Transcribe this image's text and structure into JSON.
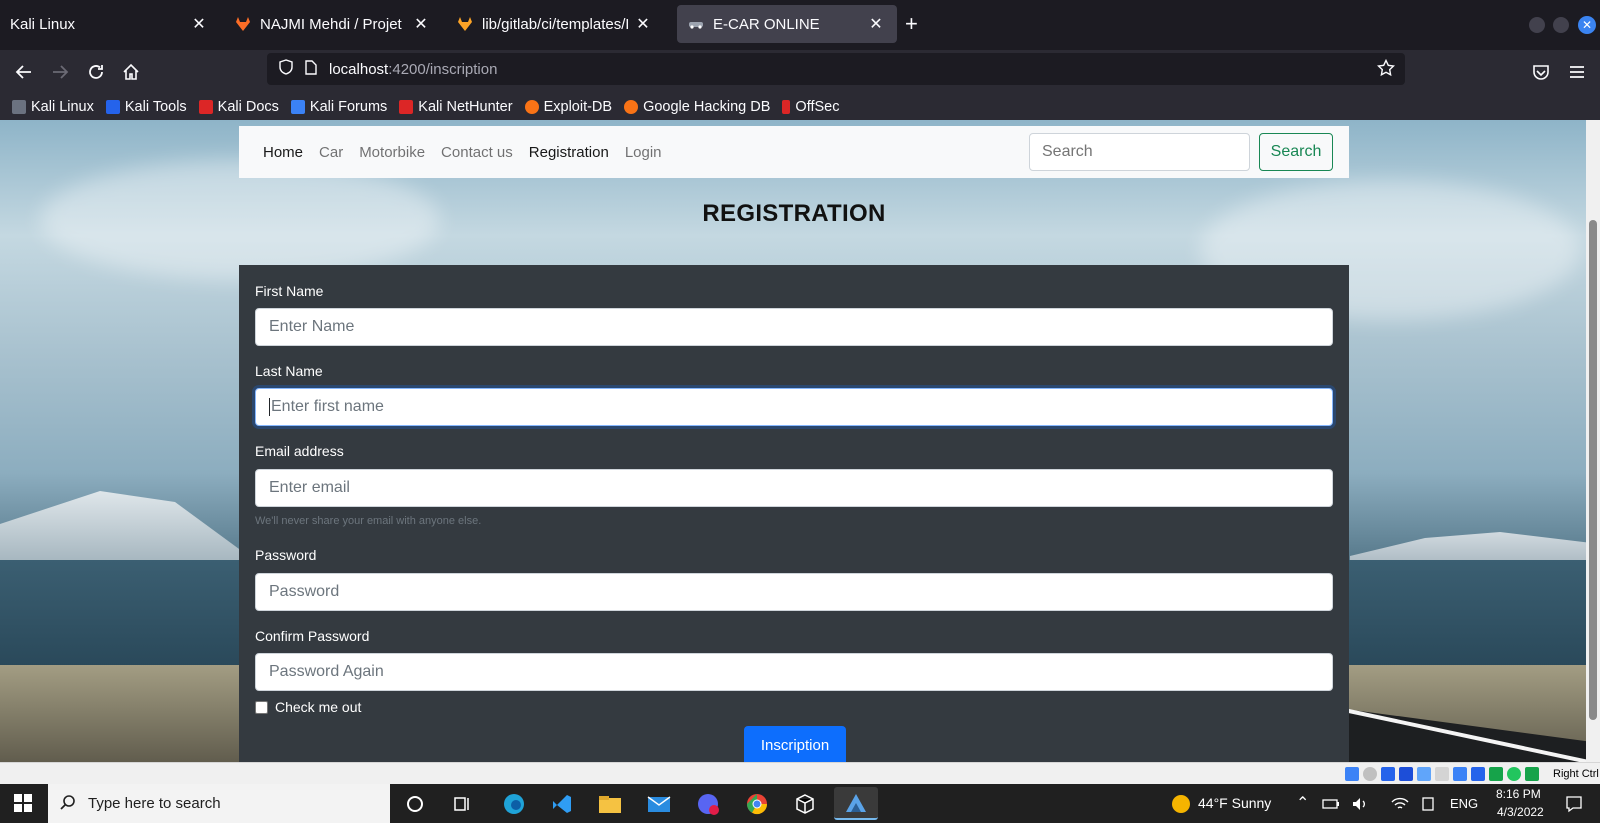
{
  "browser": {
    "tabs": [
      {
        "title": "Kali Linux",
        "active": false
      },
      {
        "title": "NAJMI Mehdi / Projet Full_",
        "active": false
      },
      {
        "title": "lib/gitlab/ci/templates/Do",
        "active": false
      },
      {
        "title": "E-CAR ONLINE",
        "active": true
      }
    ],
    "url": {
      "host": "localhost",
      "path": ":4200/inscription"
    },
    "bookmarks": [
      {
        "label": "Kali Linux",
        "icon": "kali-dragon-icon",
        "color": "#6b7280"
      },
      {
        "label": "Kali Tools",
        "icon": "kali-tools-icon",
        "color": "#2563eb"
      },
      {
        "label": "Kali Docs",
        "icon": "kali-docs-icon",
        "color": "#dc2626"
      },
      {
        "label": "Kali Forums",
        "icon": "kali-forums-icon",
        "color": "#3b82f6"
      },
      {
        "label": "Kali NetHunter",
        "icon": "nethunter-icon",
        "color": "#dc2626"
      },
      {
        "label": "Exploit-DB",
        "icon": "exploit-db-icon",
        "color": "#f97316"
      },
      {
        "label": "Google Hacking DB",
        "icon": "ghdb-icon",
        "color": "#f97316"
      },
      {
        "label": "OffSec",
        "icon": "offsec-icon",
        "color": "#dc2626"
      }
    ]
  },
  "site": {
    "nav": [
      {
        "label": "Home",
        "strong": true
      },
      {
        "label": "Car",
        "strong": false
      },
      {
        "label": "Motorbike",
        "strong": false
      },
      {
        "label": "Contact us",
        "strong": false
      },
      {
        "label": "Registration",
        "strong": true
      },
      {
        "label": "Login",
        "strong": false
      }
    ],
    "search": {
      "placeholder": "Search",
      "button": "Search"
    },
    "title": "REGISTRATION",
    "form": {
      "first_name": {
        "label": "First Name",
        "placeholder": "Enter Name"
      },
      "last_name": {
        "label": "Last Name",
        "placeholder": "Enter first name"
      },
      "email": {
        "label": "Email address",
        "placeholder": "Enter email",
        "help": "We'll never share your email with anyone else."
      },
      "password": {
        "label": "Password",
        "placeholder": "Password"
      },
      "confirm": {
        "label": "Confirm Password",
        "placeholder": "Password Again"
      },
      "check": "Check me out",
      "submit": "Inscription"
    }
  },
  "vbox": {
    "host_key": "Right Ctrl"
  },
  "taskbar": {
    "search_placeholder": "Type here to search",
    "weather": "44°F  Sunny",
    "lang": "ENG",
    "time": "8:16 PM",
    "date": "4/3/2022"
  },
  "colors": {
    "accent": "#0d6efd",
    "success": "#198754",
    "card": "#343a40",
    "brand_tab": "#42414d"
  }
}
